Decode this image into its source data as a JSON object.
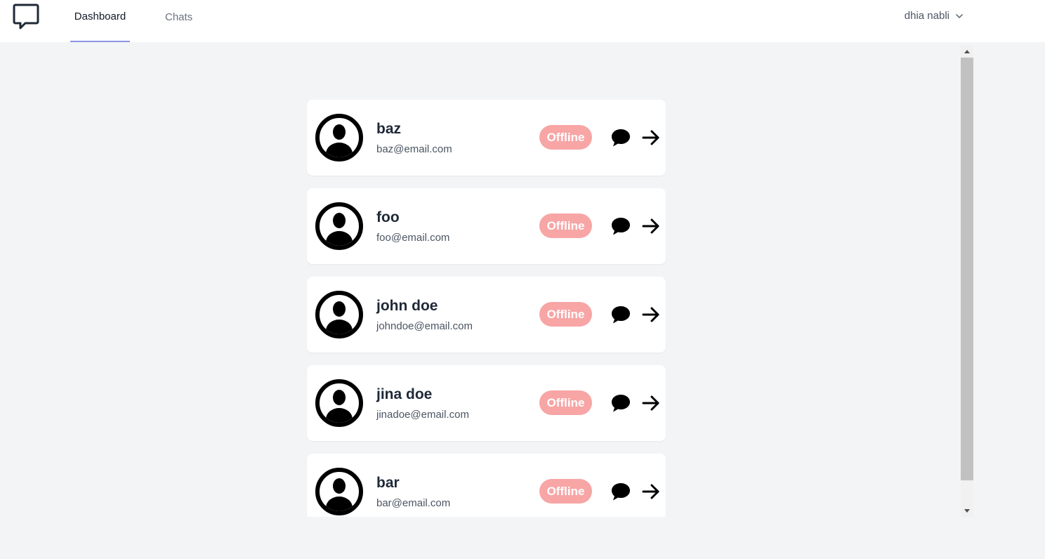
{
  "nav": {
    "logo_icon": "chat-bubble-icon",
    "tabs": [
      {
        "label": "Dashboard",
        "active": true
      },
      {
        "label": "Chats",
        "active": false
      }
    ],
    "user": {
      "name": "dhia nabli",
      "icon": "chevron-down-icon"
    }
  },
  "users": [
    {
      "name": "baz",
      "email": "baz@email.com",
      "status": "Offline"
    },
    {
      "name": "foo",
      "email": "foo@email.com",
      "status": "Offline"
    },
    {
      "name": "john doe",
      "email": "johndoe@email.com",
      "status": "Offline"
    },
    {
      "name": "jina doe",
      "email": "jinadoe@email.com",
      "status": "Offline"
    },
    {
      "name": "bar",
      "email": "bar@email.com",
      "status": "Offline"
    }
  ],
  "colors": {
    "offline_badge": "#f8a5a5",
    "active_tab_underline": "#8b95e3",
    "background": "#f3f4f6"
  }
}
